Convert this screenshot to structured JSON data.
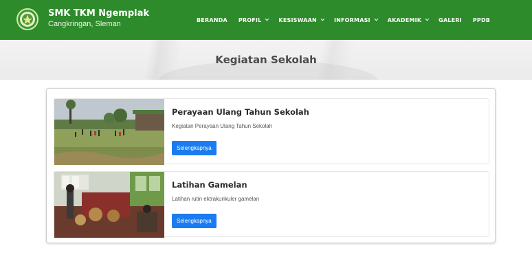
{
  "header": {
    "brand_title": "SMK TKM Ngemplak",
    "brand_subtitle": "Cangkringan, Sleman",
    "brand_color": "#2e8b2b"
  },
  "nav": {
    "items": [
      {
        "label": "BERANDA",
        "dropdown": false
      },
      {
        "label": "PROFIL",
        "dropdown": true
      },
      {
        "label": "KESISWAAN",
        "dropdown": true
      },
      {
        "label": "INFORMASI",
        "dropdown": true
      },
      {
        "label": "AKADEMIK",
        "dropdown": true
      },
      {
        "label": "GALERI",
        "dropdown": false
      },
      {
        "label": "PPDB",
        "dropdown": false
      }
    ]
  },
  "hero": {
    "title": "Kegiatan Sekolah"
  },
  "activities": [
    {
      "title": "Perayaan Ulang Tahun Sekolah",
      "description": "Kegiatan Perayaan Ulang Tahun Sekolah",
      "button_label": "Selengkapnya",
      "image_icon": "field-photo"
    },
    {
      "title": "Latihan Gamelan",
      "description": "Latihan rutin ektrakurikuler gamelan",
      "button_label": "Selengkapnya",
      "image_icon": "gamelan-photo"
    }
  ],
  "colors": {
    "button": "#1a7cf0",
    "nav_text": "#ffffff"
  }
}
